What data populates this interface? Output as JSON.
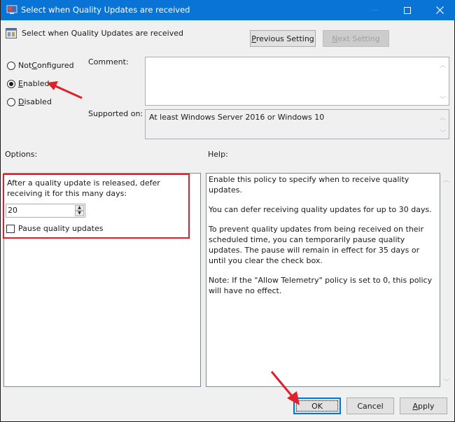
{
  "window": {
    "title": "Select when Quality Updates are received",
    "controls": {
      "minimize": "Minimize",
      "maximize": "Maximize",
      "close": "Close"
    }
  },
  "header": {
    "setting_title": "Select when Quality Updates are received",
    "previous_setting": {
      "prefix": "",
      "accel": "P",
      "rest": "revious Setting"
    },
    "next_setting": {
      "prefix": "",
      "accel": "N",
      "rest": "ext Setting"
    }
  },
  "state": {
    "options": [
      {
        "prefix": "Not ",
        "accel": "C",
        "rest": "onfigured",
        "selected": false
      },
      {
        "prefix": "",
        "accel": "E",
        "rest": "nabled",
        "selected": true
      },
      {
        "prefix": "",
        "accel": "D",
        "rest": "isabled",
        "selected": false
      }
    ]
  },
  "comment": {
    "label": "Comment:",
    "value": ""
  },
  "supported": {
    "label": "Supported on:",
    "value": "At least Windows Server 2016 or Windows 10"
  },
  "options_section": {
    "label": "Options:",
    "defer_label": "After a quality update is released, defer receiving it for this many days:",
    "defer_days": "20",
    "pause_label": "Pause quality updates",
    "pause_checked": false
  },
  "help_section": {
    "label": "Help:",
    "paragraphs": [
      "Enable this policy to specify when to receive quality updates.",
      "You can defer receiving quality updates for up to 30 days.",
      "To prevent quality updates from being received on their scheduled time, you can temporarily pause quality updates. The pause will remain in effect for 35 days or until you clear the check box.",
      "Note: If the \"Allow Telemetry\" policy is set to 0, this policy will have no effect."
    ]
  },
  "footer": {
    "ok": "OK",
    "cancel": "Cancel",
    "apply": {
      "accel": "A",
      "rest": "pply"
    }
  },
  "annotations": {
    "highlight_color": "#e0202a"
  },
  "colors": {
    "titlebar": "#0a73d6",
    "background": "#f0f0f0"
  }
}
